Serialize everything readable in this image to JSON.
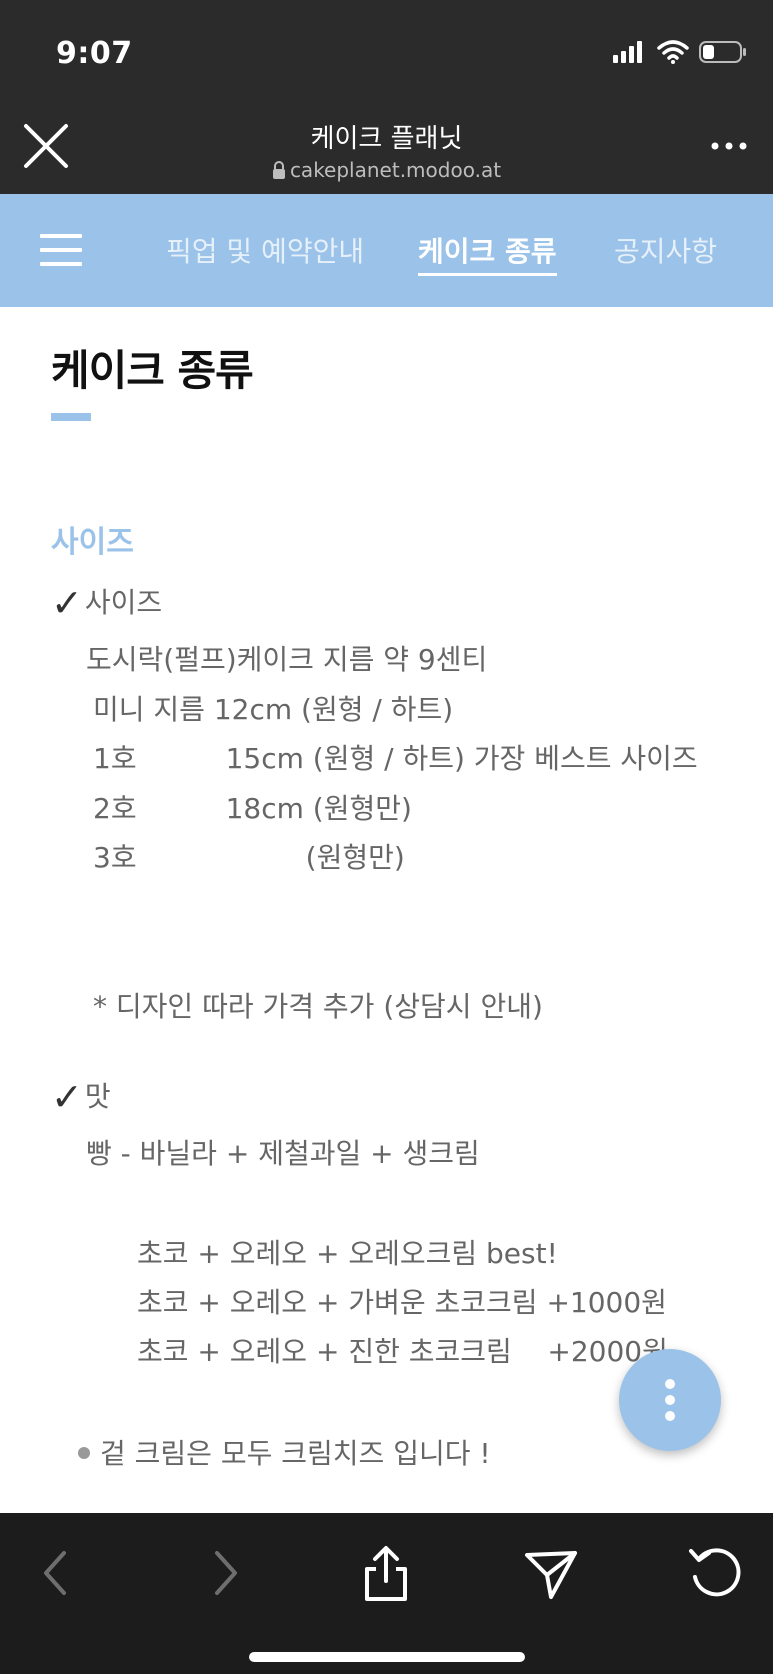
{
  "status_bar": {
    "time": "9:07",
    "icons": [
      "cellular-signal-icon",
      "wifi-icon",
      "battery-icon"
    ]
  },
  "browser": {
    "title": "케이크 플래닛",
    "url": "cakeplanet.modoo.at",
    "close_icon": "close-icon",
    "more_icon": "more-icon"
  },
  "site_nav": {
    "menu_icon": "hamburger-icon",
    "tabs": [
      {
        "label": "픽업 및 예약안내",
        "active": false
      },
      {
        "label": "케이크 종류",
        "active": true
      },
      {
        "label": "공지사항",
        "active": false
      }
    ]
  },
  "page": {
    "title": "케이크 종류",
    "section_heading": "사이즈",
    "size_header": "사이즈",
    "size_lines": [
      "도시락(펄프)케이크 지름 약 9센티",
      "미니 지름 12cm (원형 / 하트)",
      "1호          15cm (원형 / 하트) 가장 베스트 사이즈",
      "2호          18cm (원형만)",
      "3호                   (원형만)"
    ],
    "size_note": "* 디자인 따라 가격 추가 (상담시 안내)",
    "taste_header": "맛",
    "taste_lines": [
      "빵 - 바닐라 + 제철과일 + 생크림",
      "초코 + 오레오 + 오레오크림 best!",
      "초코 + 오레오 + 가벼운 초코크림 +1000원",
      "초코 + 오레오 + 진한 초코크림    +2000원"
    ],
    "cream_note": "겉 크림은 모두 크림치즈 입니다 !"
  },
  "toolbar": {
    "buttons": [
      "back-icon",
      "forward-icon",
      "share-icon",
      "send-icon",
      "reload-icon"
    ]
  },
  "colors": {
    "accent": "#9bc2e8",
    "header_bg": "#2b2b2b",
    "toolbar_bg": "#1c1c1c",
    "body_text": "#666666"
  }
}
